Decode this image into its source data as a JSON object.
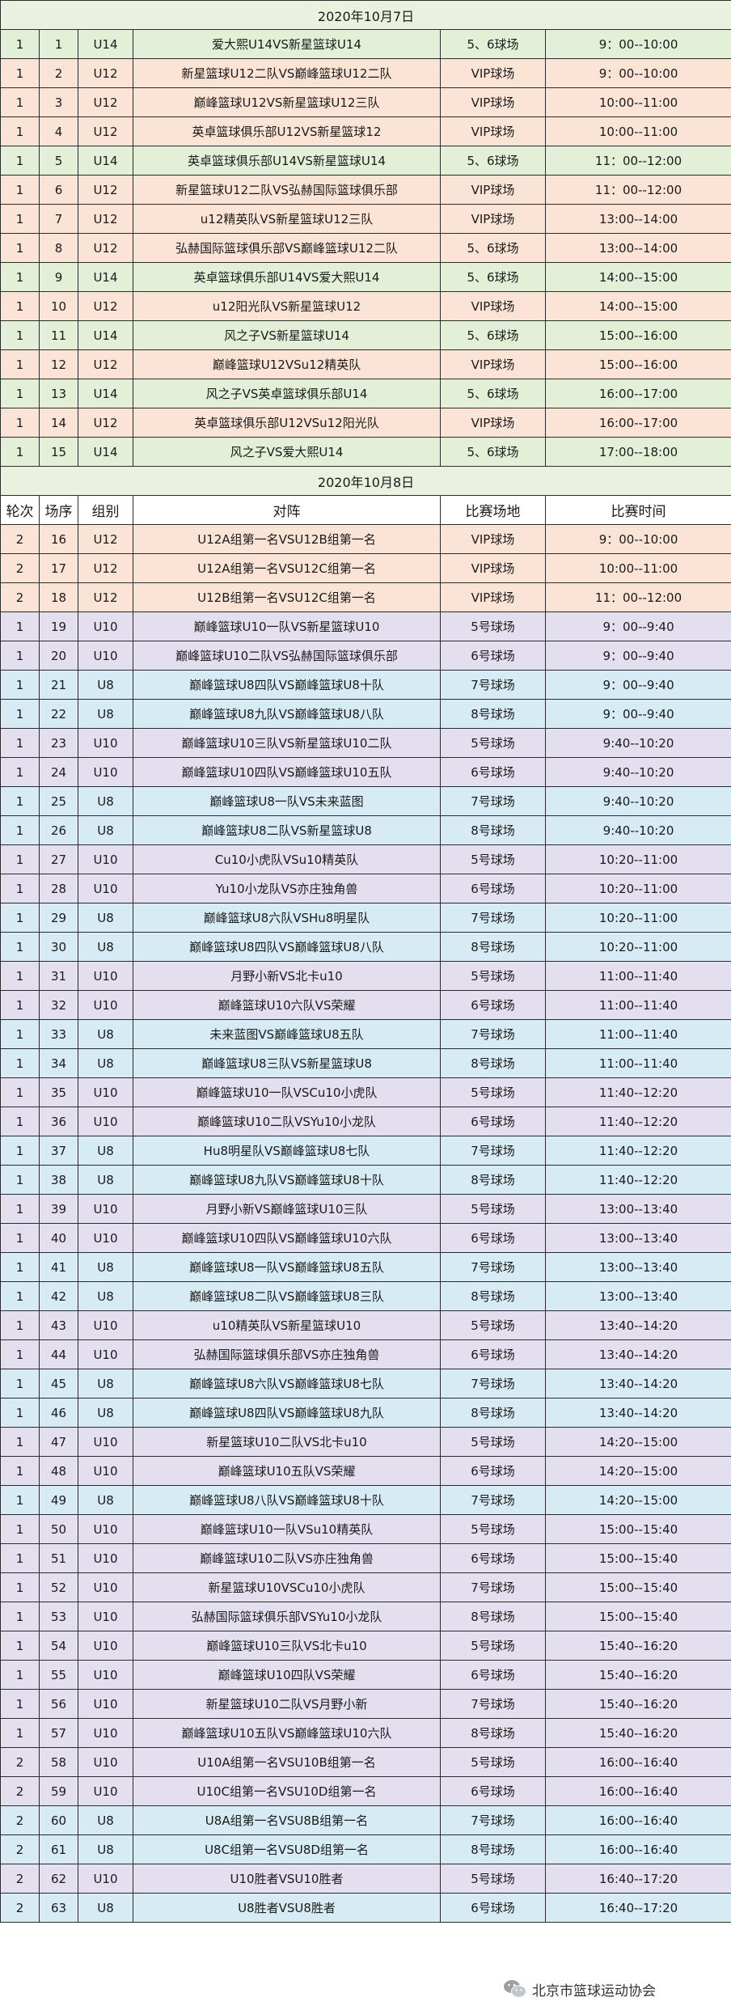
{
  "headers": [
    "轮次",
    "场序",
    "组别",
    "对阵",
    "比赛场地",
    "比赛时间"
  ],
  "sections": [
    {
      "title": "2020年10月7日",
      "show_header": false,
      "rows": [
        {
          "round": "1",
          "seq": "1",
          "group": "U14",
          "match": "爱大熙U14VS新星篮球U14",
          "venue": "5、6球场",
          "time": "9：00--10:00"
        },
        {
          "round": "1",
          "seq": "2",
          "group": "U12",
          "match": "新星篮球U12二队VS巅峰篮球U12二队",
          "venue": "VIP球场",
          "time": "9：00--10:00"
        },
        {
          "round": "1",
          "seq": "3",
          "group": "U12",
          "match": "巅峰篮球U12VS新星篮球U12三队",
          "venue": "VIP球场",
          "time": "10:00--11:00"
        },
        {
          "round": "1",
          "seq": "4",
          "group": "U12",
          "match": "英卓篮球俱乐部U12VS新星篮球12",
          "venue": "VIP球场",
          "time": "10:00--11:00"
        },
        {
          "round": "1",
          "seq": "5",
          "group": "U14",
          "match": "英卓篮球俱乐部U14VS新星篮球U14",
          "venue": "5、6球场",
          "time": "11：00--12:00"
        },
        {
          "round": "1",
          "seq": "6",
          "group": "U12",
          "match": "新星篮球U12二队VS弘赫国际篮球俱乐部",
          "venue": "VIP球场",
          "time": "11：00--12:00"
        },
        {
          "round": "1",
          "seq": "7",
          "group": "U12",
          "match": "u12精英队VS新星篮球U12三队",
          "venue": "VIP球场",
          "time": "13:00--14:00"
        },
        {
          "round": "1",
          "seq": "8",
          "group": "U12",
          "match": "弘赫国际篮球俱乐部VS巅峰篮球U12二队",
          "venue": "5、6球场",
          "time": "13:00--14:00"
        },
        {
          "round": "1",
          "seq": "9",
          "group": "U14",
          "match": "英卓篮球俱乐部U14VS爱大熙U14",
          "venue": "5、6球场",
          "time": "14:00--15:00"
        },
        {
          "round": "1",
          "seq": "10",
          "group": "U12",
          "match": "u12阳光队VS新星篮球U12",
          "venue": "VIP球场",
          "time": "14:00--15:00"
        },
        {
          "round": "1",
          "seq": "11",
          "group": "U14",
          "match": "风之子VS新星篮球U14",
          "venue": "5、6球场",
          "time": "15:00--16:00"
        },
        {
          "round": "1",
          "seq": "12",
          "group": "U12",
          "match": "巅峰篮球U12VSu12精英队",
          "venue": "VIP球场",
          "time": "15:00--16:00"
        },
        {
          "round": "1",
          "seq": "13",
          "group": "U14",
          "match": "风之子VS英卓篮球俱乐部U14",
          "venue": "5、6球场",
          "time": "16:00--17:00"
        },
        {
          "round": "1",
          "seq": "14",
          "group": "U12",
          "match": "英卓篮球俱乐部U12VSu12阳光队",
          "venue": "VIP球场",
          "time": "16:00--17:00"
        },
        {
          "round": "1",
          "seq": "15",
          "group": "U14",
          "match": "风之子VS爱大熙U14",
          "venue": "5、6球场",
          "time": "17:00--18:00"
        }
      ]
    },
    {
      "title": "2020年10月8日",
      "show_header": true,
      "rows": [
        {
          "round": "2",
          "seq": "16",
          "group": "U12",
          "match": "U12A组第一名VSU12B组第一名",
          "venue": "VIP球场",
          "time": "9：00--10:00"
        },
        {
          "round": "2",
          "seq": "17",
          "group": "U12",
          "match": "U12A组第一名VSU12C组第一名",
          "venue": "VIP球场",
          "time": "10:00--11:00"
        },
        {
          "round": "2",
          "seq": "18",
          "group": "U12",
          "match": "U12B组第一名VSU12C组第一名",
          "venue": "VIP球场",
          "time": "11：00--12:00"
        },
        {
          "round": "1",
          "seq": "19",
          "group": "U10",
          "match": "巅峰篮球U10一队VS新星篮球U10",
          "venue": "5号球场",
          "time": "9：00--9:40"
        },
        {
          "round": "1",
          "seq": "20",
          "group": "U10",
          "match": "巅峰篮球U10二队VS弘赫国际篮球俱乐部",
          "venue": "6号球场",
          "time": "9：00--9:40"
        },
        {
          "round": "1",
          "seq": "21",
          "group": "U8",
          "match": "巅峰篮球U8四队VS巅峰篮球U8十队",
          "venue": "7号球场",
          "time": "9：00--9:40"
        },
        {
          "round": "1",
          "seq": "22",
          "group": "U8",
          "match": "巅峰篮球U8九队VS巅峰篮球U8八队",
          "venue": "8号球场",
          "time": "9：00--9:40"
        },
        {
          "round": "1",
          "seq": "23",
          "group": "U10",
          "match": "巅峰篮球U10三队VS新星篮球U10二队",
          "venue": "5号球场",
          "time": "9:40--10:20"
        },
        {
          "round": "1",
          "seq": "24",
          "group": "U10",
          "match": "巅峰篮球U10四队VS巅峰篮球U10五队",
          "venue": "6号球场",
          "time": "9:40--10:20"
        },
        {
          "round": "1",
          "seq": "25",
          "group": "U8",
          "match": "巅峰篮球U8一队VS未来蓝图",
          "venue": "7号球场",
          "time": "9:40--10:20"
        },
        {
          "round": "1",
          "seq": "26",
          "group": "U8",
          "match": "巅峰篮球U8二队VS新星篮球U8",
          "venue": "8号球场",
          "time": "9:40--10:20"
        },
        {
          "round": "1",
          "seq": "27",
          "group": "U10",
          "match": "Cu10小虎队VSu10精英队",
          "venue": "5号球场",
          "time": "10:20--11:00"
        },
        {
          "round": "1",
          "seq": "28",
          "group": "U10",
          "match": "Yu10小龙队VS亦庄独角兽",
          "venue": "6号球场",
          "time": "10:20--11:00"
        },
        {
          "round": "1",
          "seq": "29",
          "group": "U8",
          "match": "巅峰篮球U8六队VSHu8明星队",
          "venue": "7号球场",
          "time": "10:20--11:00"
        },
        {
          "round": "1",
          "seq": "30",
          "group": "U8",
          "match": "巅峰篮球U8四队VS巅峰篮球U8八队",
          "venue": "8号球场",
          "time": "10:20--11:00"
        },
        {
          "round": "1",
          "seq": "31",
          "group": "U10",
          "match": "月野小新VS北卡u10",
          "venue": "5号球场",
          "time": "11:00--11:40"
        },
        {
          "round": "1",
          "seq": "32",
          "group": "U10",
          "match": "巅峰篮球U10六队VS荣耀",
          "venue": "6号球场",
          "time": "11:00--11:40"
        },
        {
          "round": "1",
          "seq": "33",
          "group": "U8",
          "match": "未来蓝图VS巅峰篮球U8五队",
          "venue": "7号球场",
          "time": "11:00--11:40"
        },
        {
          "round": "1",
          "seq": "34",
          "group": "U8",
          "match": "巅峰篮球U8三队VS新星篮球U8",
          "venue": "8号球场",
          "time": "11:00--11:40"
        },
        {
          "round": "1",
          "seq": "35",
          "group": "U10",
          "match": "巅峰篮球U10一队VSCu10小虎队",
          "venue": "5号球场",
          "time": "11:40--12:20"
        },
        {
          "round": "1",
          "seq": "36",
          "group": "U10",
          "match": "巅峰篮球U10二队VSYu10小龙队",
          "venue": "6号球场",
          "time": "11:40--12:20"
        },
        {
          "round": "1",
          "seq": "37",
          "group": "U8",
          "match": "Hu8明星队VS巅峰篮球U8七队",
          "venue": "7号球场",
          "time": "11:40--12:20"
        },
        {
          "round": "1",
          "seq": "38",
          "group": "U8",
          "match": "巅峰篮球U8九队VS巅峰篮球U8十队",
          "venue": "8号球场",
          "time": "11:40--12:20"
        },
        {
          "round": "1",
          "seq": "39",
          "group": "U10",
          "match": "月野小新VS巅峰篮球U10三队",
          "venue": "5号球场",
          "time": "13:00--13:40"
        },
        {
          "round": "1",
          "seq": "40",
          "group": "U10",
          "match": "巅峰篮球U10四队VS巅峰篮球U10六队",
          "venue": "6号球场",
          "time": "13:00--13:40"
        },
        {
          "round": "1",
          "seq": "41",
          "group": "U8",
          "match": "巅峰篮球U8一队VS巅峰篮球U8五队",
          "venue": "7号球场",
          "time": "13:00--13:40"
        },
        {
          "round": "1",
          "seq": "42",
          "group": "U8",
          "match": "巅峰篮球U8二队VS巅峰篮球U8三队",
          "venue": "8号球场",
          "time": "13:00--13:40"
        },
        {
          "round": "1",
          "seq": "43",
          "group": "U10",
          "match": "u10精英队VS新星篮球U10",
          "venue": "5号球场",
          "time": "13:40--14:20"
        },
        {
          "round": "1",
          "seq": "44",
          "group": "U10",
          "match": "弘赫国际篮球俱乐部VS亦庄独角兽",
          "venue": "6号球场",
          "time": "13:40--14:20"
        },
        {
          "round": "1",
          "seq": "45",
          "group": "U8",
          "match": "巅峰篮球U8六队VS巅峰篮球U8七队",
          "venue": "7号球场",
          "time": "13:40--14:20"
        },
        {
          "round": "1",
          "seq": "46",
          "group": "U8",
          "match": "巅峰篮球U8四队VS巅峰篮球U8九队",
          "venue": "8号球场",
          "time": "13:40--14:20"
        },
        {
          "round": "1",
          "seq": "47",
          "group": "U10",
          "match": "新星篮球U10二队VS北卡u10",
          "venue": "5号球场",
          "time": "14:20--15:00"
        },
        {
          "round": "1",
          "seq": "48",
          "group": "U10",
          "match": "巅峰篮球U10五队VS荣耀",
          "venue": "6号球场",
          "time": "14:20--15:00"
        },
        {
          "round": "1",
          "seq": "49",
          "group": "U8",
          "match": "巅峰篮球U8八队VS巅峰篮球U8十队",
          "venue": "7号球场",
          "time": "14:20--15:00"
        },
        {
          "round": "1",
          "seq": "50",
          "group": "U10",
          "match": "巅峰篮球U10一队VSu10精英队",
          "venue": "5号球场",
          "time": "15:00--15:40"
        },
        {
          "round": "1",
          "seq": "51",
          "group": "U10",
          "match": "巅峰篮球U10二队VS亦庄独角兽",
          "venue": "6号球场",
          "time": "15:00--15:40"
        },
        {
          "round": "1",
          "seq": "52",
          "group": "U10",
          "match": "新星篮球U10VSCu10小虎队",
          "venue": "7号球场",
          "time": "15:00--15:40"
        },
        {
          "round": "1",
          "seq": "53",
          "group": "U10",
          "match": "弘赫国际篮球俱乐部VSYu10小龙队",
          "venue": "8号球场",
          "time": "15:00--15:40"
        },
        {
          "round": "1",
          "seq": "54",
          "group": "U10",
          "match": "巅峰篮球U10三队VS北卡u10",
          "venue": "5号球场",
          "time": "15:40--16:20"
        },
        {
          "round": "1",
          "seq": "55",
          "group": "U10",
          "match": "巅峰篮球U10四队VS荣耀",
          "venue": "6号球场",
          "time": "15:40--16:20"
        },
        {
          "round": "1",
          "seq": "56",
          "group": "U10",
          "match": "新星篮球U10二队VS月野小新",
          "venue": "7号球场",
          "time": "15:40--16:20"
        },
        {
          "round": "1",
          "seq": "57",
          "group": "U10",
          "match": "巅峰篮球U10五队VS巅峰篮球U10六队",
          "venue": "8号球场",
          "time": "15:40--16:20"
        },
        {
          "round": "2",
          "seq": "58",
          "group": "U10",
          "match": "U10A组第一名VSU10B组第一名",
          "venue": "5号球场",
          "time": "16:00--16:40"
        },
        {
          "round": "2",
          "seq": "59",
          "group": "U10",
          "match": "U10C组第一名VSU10D组第一名",
          "venue": "6号球场",
          "time": "16:00--16:40"
        },
        {
          "round": "2",
          "seq": "60",
          "group": "U8",
          "match": "U8A组第一名VSU8B组第一名",
          "venue": "7号球场",
          "time": "16:00--16:40"
        },
        {
          "round": "2",
          "seq": "61",
          "group": "U8",
          "match": "U8C组第一名VSU8D组第一名",
          "venue": "8号球场",
          "time": "16:00--16:40"
        },
        {
          "round": "2",
          "seq": "62",
          "group": "U10",
          "match": "U10胜者VSU10胜者",
          "venue": "5号球场",
          "time": "16:40--17:20"
        },
        {
          "round": "2",
          "seq": "63",
          "group": "U8",
          "match": "U8胜者VSU8胜者",
          "venue": "6号球场",
          "time": "16:40--17:20"
        }
      ]
    }
  ],
  "footer": {
    "icon": "wechat-icon",
    "text": "北京市篮球运动协会"
  }
}
